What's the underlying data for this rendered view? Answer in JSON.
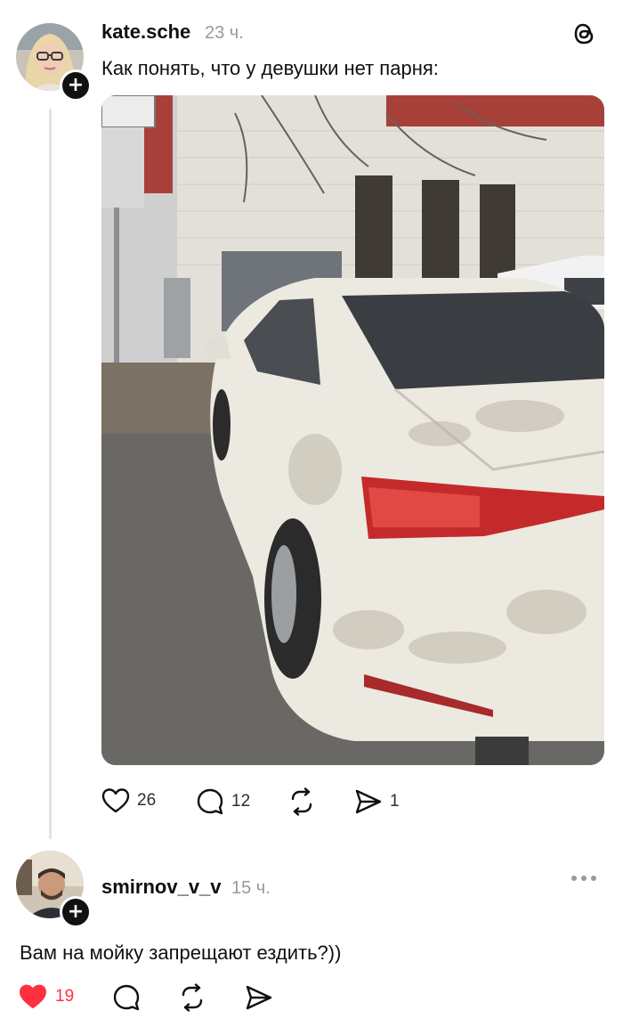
{
  "post": {
    "username": "kate.sche",
    "time": "23 ч.",
    "text": "Как понять, что у девушки нет парня:",
    "likes": "26",
    "comments": "12",
    "shares": "1"
  },
  "reply": {
    "username": "smirnov_v_v",
    "time": "15 ч.",
    "text": "Вам на мойку запрещают ездить?))",
    "likes": "19",
    "liked": true
  },
  "icons": {
    "app_logo": "threads-logo-icon",
    "plus": "plus-icon",
    "like": "heart-icon",
    "comment": "comment-bubble-icon",
    "repost": "repost-icon",
    "share": "send-icon",
    "more": "more-dots-icon"
  },
  "colors": {
    "accent_like": "#ff3040",
    "muted": "#9a9a9a",
    "text": "#101010"
  }
}
